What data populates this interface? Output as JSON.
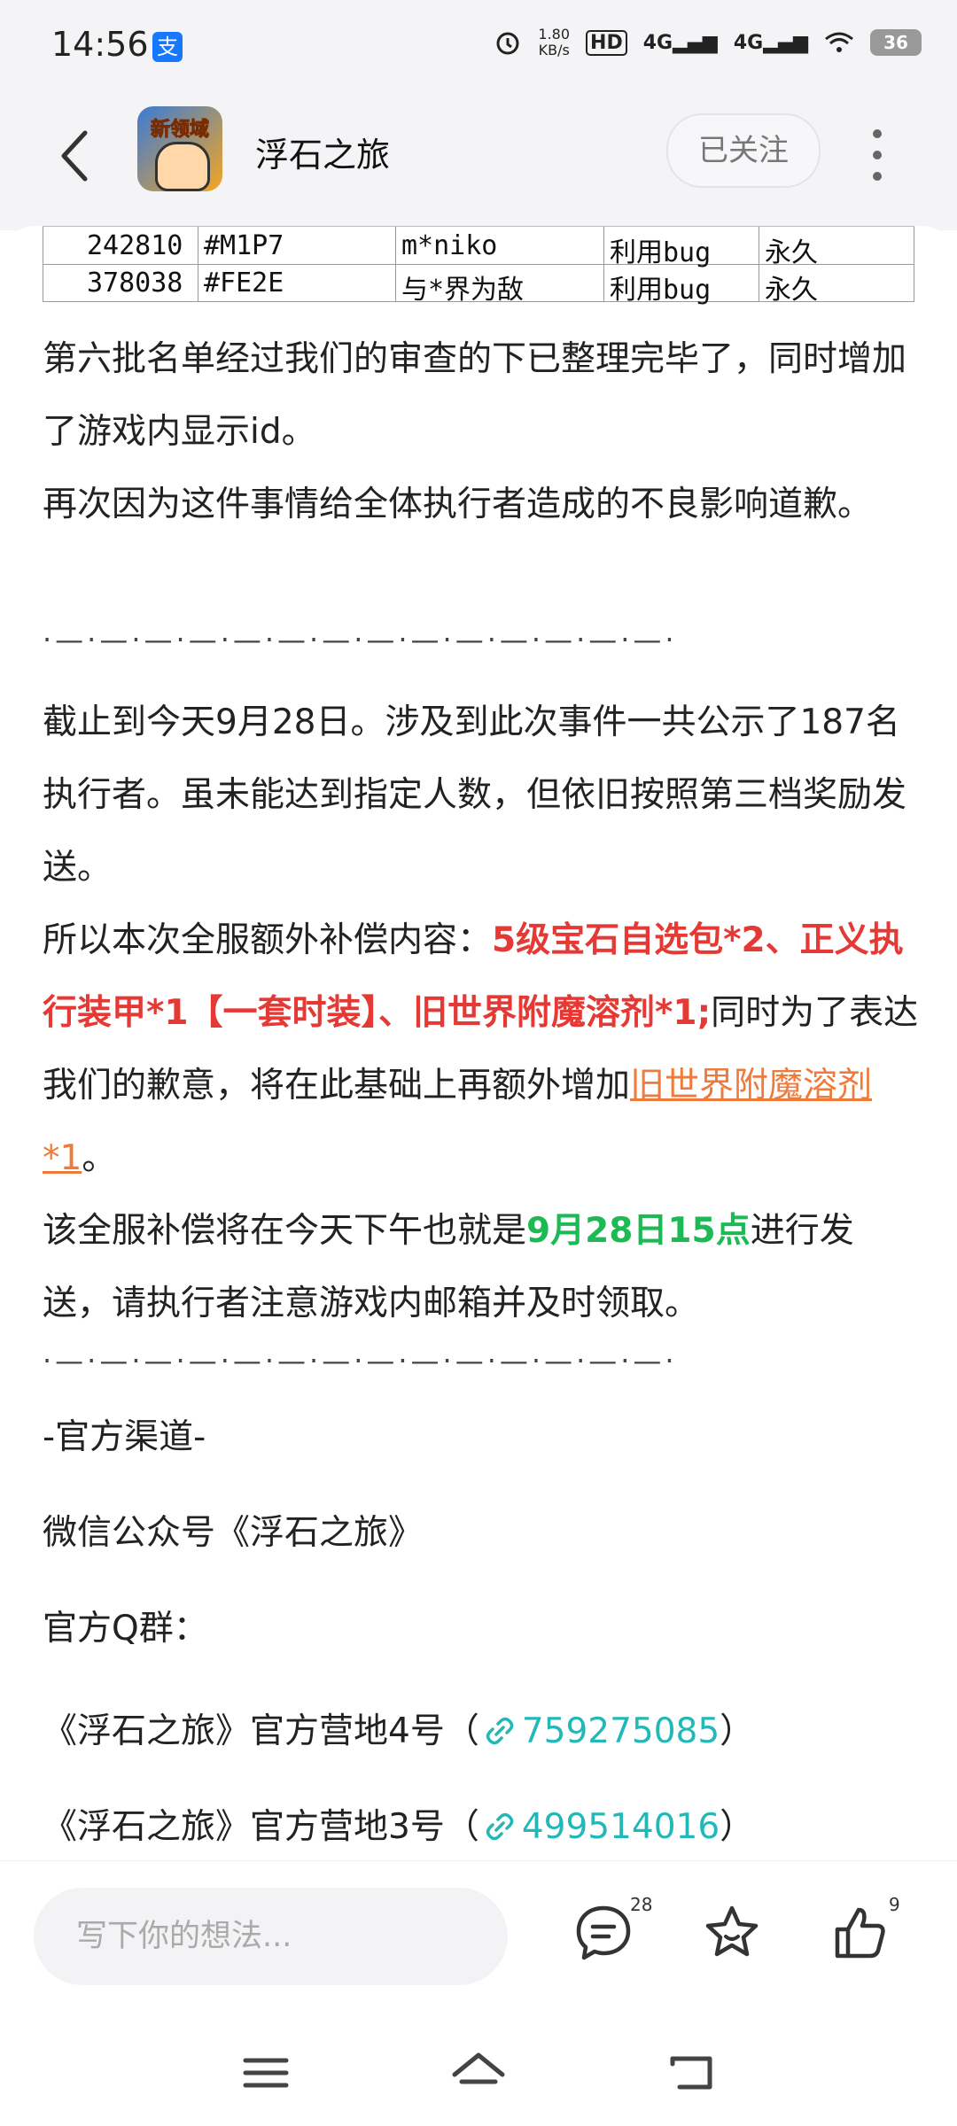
{
  "status_bar": {
    "time": "14:56",
    "app_badge": "支",
    "net_speed_value": "1.80",
    "net_speed_unit": "KB/s",
    "hd_label": "HD",
    "signal1": "4G",
    "signal2": "4G",
    "battery": "36"
  },
  "header": {
    "title": "浮石之旅",
    "follow_label": "已关注",
    "app_icon_text": "新领域"
  },
  "table": {
    "rows": [
      {
        "id": "242810",
        "code": "#M1P7",
        "name": "m*niko",
        "reason": "利用bug",
        "duration": "永久"
      },
      {
        "id": "378038",
        "code": "#FE2E",
        "name": "与*界为敌",
        "reason": "利用bug",
        "duration": "永久"
      }
    ]
  },
  "article": {
    "p1": "第六批名单经过我们的审查的下已整理完毕了，同时增加了游戏内显示id。",
    "p2": "再次因为这件事情给全体执行者造成的不良影响道歉。",
    "divider": "·—·—·—·—·—·—·—·—·—·—·—·—·—·—·",
    "p3": "截止到今天9月28日。涉及到此次事件一共公示了187名执行者。虽未能达到指定人数，但依旧按照第三档奖励发送。",
    "p4_prefix": "所以本次全服额外补偿内容：",
    "p4_red": "5级宝石自选包*2、正义执行装甲*1【一套时装】、旧世界附魔溶剂*1;",
    "p4_mid": "同时为了表达我们的歉意，将在此基础上再额外增加",
    "p4_link": "旧世界附魔溶剂*1",
    "p4_end": "。",
    "p5_prefix": "该全服补偿将在今天下午也就是",
    "p5_green": "9月28日15点",
    "p5_suffix": "进行发送，请执行者注意游戏内邮箱并及时领取。",
    "channels_title": "-官方渠道-",
    "wechat": "微信公众号《浮石之旅》",
    "qq_title": "官方Q群：",
    "group4_prefix": "《浮石之旅》官方营地4号（",
    "group4_num": "759275085",
    "group4_suffix": "）",
    "group3_prefix": "《浮石之旅》官方营地3号（",
    "group3_num": "499514016",
    "group3_suffix": "）"
  },
  "bottom_bar": {
    "comment_placeholder": "写下你的想法...",
    "comment_count": "28",
    "like_count": "9"
  },
  "colors": {
    "red_highlight": "#e53935",
    "green_highlight": "#1db954",
    "link_orange": "#f07a3a",
    "teal_link": "#22b8b8",
    "background": "#f4f4f6"
  }
}
